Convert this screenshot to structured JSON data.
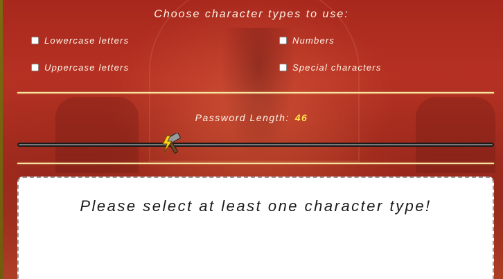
{
  "title": "Choose character types to use:",
  "options": [
    {
      "label": "Lowercase letters",
      "checked": false
    },
    {
      "label": "Numbers",
      "checked": false
    },
    {
      "label": "Uppercase letters",
      "checked": false
    },
    {
      "label": "Special characters",
      "checked": false
    }
  ],
  "length": {
    "label": "Password Length:",
    "value": "46"
  },
  "output": {
    "message": "Please select at least one character type!"
  },
  "colors": {
    "background": "#b3301f",
    "divider": "#f7e3a0",
    "length_value": "#ffe54a",
    "output_text": "#1a1a1a"
  },
  "icons": {
    "slider_thumb": "hammer-lightning-icon"
  }
}
